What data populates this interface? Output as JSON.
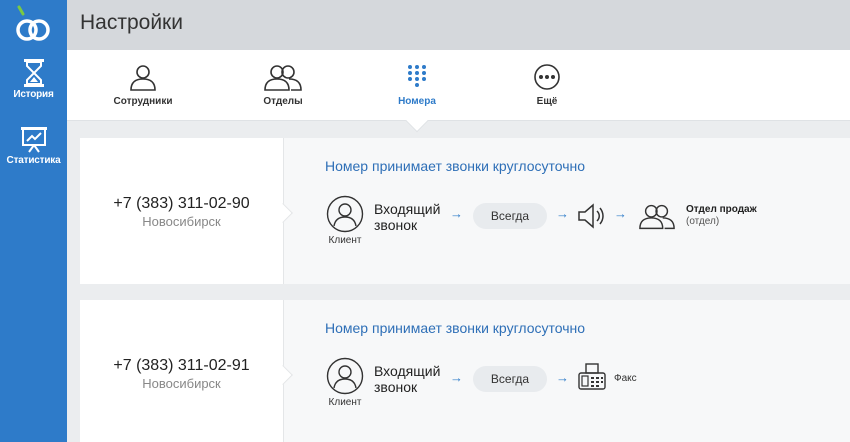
{
  "header": {
    "title": "Настройки"
  },
  "sidebar": {
    "items": [
      {
        "label": "История",
        "icon": "hourglass-icon"
      },
      {
        "label": "Статистика",
        "icon": "chart-icon"
      }
    ]
  },
  "tabs": [
    {
      "label": "Сотрудники",
      "icon": "person-icon"
    },
    {
      "label": "Отделы",
      "icon": "group-icon"
    },
    {
      "label": "Номера",
      "icon": "keypad-icon",
      "active": true
    },
    {
      "label": "Ещё",
      "icon": "more-icon"
    }
  ],
  "numbers": [
    {
      "phone": "+7 (383) 311-02-90",
      "city": "Новосибирск",
      "schedule": "Номер принимает звонки круглосуточно",
      "client_label": "Клиент",
      "incoming": "Входящий звонок",
      "incoming_line1": "Входящий",
      "incoming_line2": "звонок",
      "condition": "Всегда",
      "destination": "Отдел продаж",
      "destination_type": "(отдел)"
    },
    {
      "phone": "+7 (383) 311-02-91",
      "city": "Новосибирск",
      "schedule": "Номер принимает звонки круглосуточно",
      "client_label": "Клиент",
      "incoming_line1": "Входящий",
      "incoming_line2": "звонок",
      "condition": "Всегда",
      "destination": "Факс"
    }
  ],
  "colors": {
    "sidebar": "#2e7bc9",
    "accent": "#2e7bc9",
    "link": "#2e6fb7",
    "header": "#d5d8dc"
  }
}
